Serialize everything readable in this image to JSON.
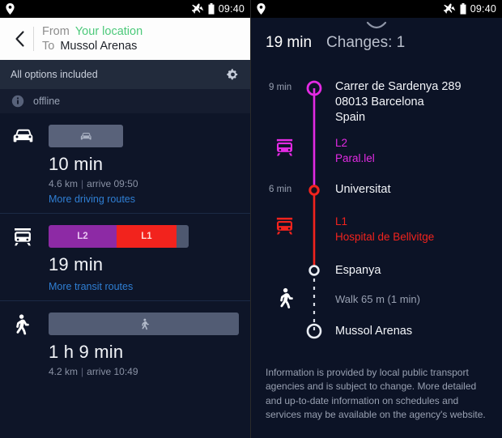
{
  "status_bar": {
    "location_icon": "location-pin-icon",
    "airplane_icon": "airplane-mode-icon",
    "battery_icon": "battery-icon",
    "time": "09:40"
  },
  "left_screen": {
    "header": {
      "back_icon": "back-chevron-icon",
      "from_label": "From",
      "from_value": "Your location",
      "to_label": "To",
      "to_value": "Mussol Arenas"
    },
    "options_bar": {
      "text": "All options included",
      "settings_icon": "gear-icon"
    },
    "offline_bar": {
      "info_icon": "info-icon",
      "text": "offline"
    },
    "options": [
      {
        "mode_icon": "car-icon",
        "bar_icon": "car-icon",
        "bar_type": "car",
        "duration": "10 min",
        "distance": "4.6 km",
        "separator": "|",
        "arrive": "arrive 09:50",
        "more_link": "More driving routes"
      },
      {
        "mode_icon": "train-icon",
        "bar_type": "transit",
        "segments": [
          {
            "label": "L2",
            "color": "#8d2aa5",
            "width": 84
          },
          {
            "label": "L1",
            "color": "#f2231d",
            "width": 74
          },
          {
            "label": "",
            "color": "#4e5870",
            "width": 15
          }
        ],
        "duration": "19 min",
        "more_link": "More transit routes"
      },
      {
        "mode_icon": "walk-icon",
        "bar_icon": "walk-icon",
        "bar_type": "walk",
        "duration": "1 h 9 min",
        "distance": "4.2 km",
        "separator": "|",
        "arrive": "arrive 10:49"
      }
    ]
  },
  "right_screen": {
    "drag_handle_icon": "chevron-handle-icon",
    "duration": "19 min",
    "changes": "Changes: 1",
    "colors": {
      "l2": "#e32ae3",
      "l1": "#f2231d",
      "walk": "#ffffff"
    },
    "timeline": [
      {
        "kind": "stop",
        "mins": "9 min",
        "node": "open-circle-magenta",
        "lines": [
          "Carrer de Sardenya 289",
          "08013 Barcelona",
          "Spain"
        ]
      },
      {
        "kind": "leg",
        "icon": "train-icon-magenta",
        "line_name": "L2",
        "destination": "Paral.lel",
        "color": "#e32ae3"
      },
      {
        "kind": "stop",
        "mins": "6 min",
        "node": "small-circle-red",
        "lines": [
          "Universitat"
        ]
      },
      {
        "kind": "leg",
        "icon": "train-icon-red",
        "line_name": "L1",
        "destination": "Hospital de Bellvitge",
        "color": "#f2231d"
      },
      {
        "kind": "stop",
        "mins": "",
        "node": "small-circle-white",
        "lines": [
          "Espanya"
        ]
      },
      {
        "kind": "leg",
        "icon": "walk-icon-white",
        "note": "Walk 65 m (1 min)",
        "color": "#ffffff"
      },
      {
        "kind": "stop",
        "mins": "",
        "node": "open-circle-white",
        "lines": [
          "Mussol Arenas"
        ]
      }
    ],
    "disclaimer": "Information is provided by local public transport agencies and is subject to change. More detailed and up-to-date information on schedules and services may be available on the agency's website."
  }
}
